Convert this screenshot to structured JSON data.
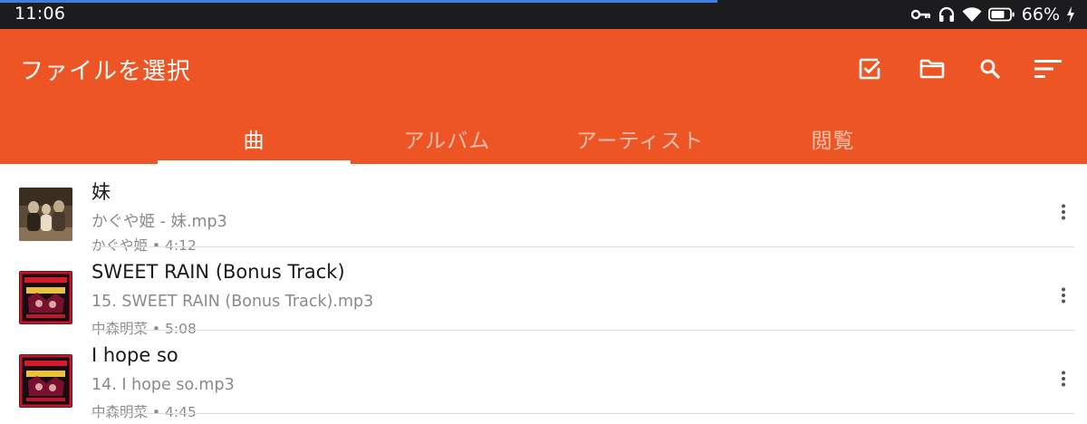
{
  "status_bar": {
    "time": "11:06",
    "battery_percent": "66%",
    "page_load_progress": 0.66,
    "icons": [
      "key-icon",
      "headphones-icon",
      "wifi-icon",
      "battery-icon",
      "charging-bolt-icon"
    ]
  },
  "app_bar": {
    "title": "ファイルを選択",
    "background_color": "#ee5524",
    "actions": [
      "select-checkbox-icon",
      "folder-icon",
      "search-icon",
      "sort-icon"
    ]
  },
  "tabs": [
    {
      "label": "曲",
      "active": true
    },
    {
      "label": "アルバム",
      "active": false
    },
    {
      "label": "アーティスト",
      "active": false
    },
    {
      "label": "閲覧",
      "active": false
    }
  ],
  "songs": [
    {
      "title": "妹",
      "filename": "かぐや姫 - 妹.mp3",
      "meta": "かぐや姫 • 4:12"
    },
    {
      "title": "SWEET RAIN (Bonus Track)",
      "filename": "15. SWEET RAIN (Bonus Track).mp3",
      "meta": "中森明菜 • 5:08"
    },
    {
      "title": "I hope so",
      "filename": "14. I hope so.mp3",
      "meta": "中森明菜 • 4:45"
    }
  ]
}
